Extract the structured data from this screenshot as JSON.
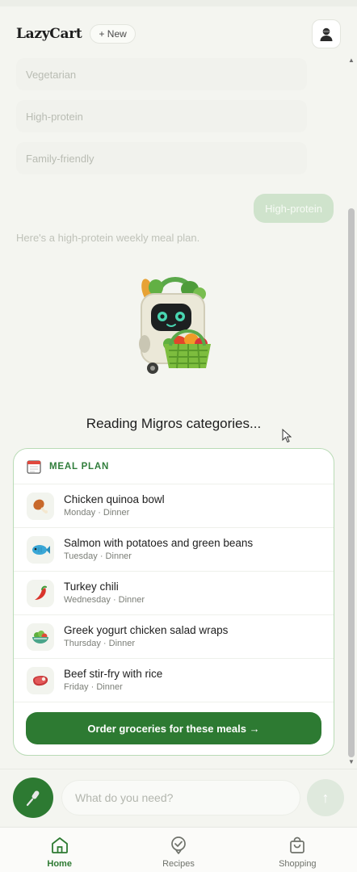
{
  "header": {
    "logo": "LazyCart",
    "new_label": "+ New",
    "profile_icon": "user-avatar-icon"
  },
  "chat": {
    "options": [
      "Vegetarian",
      "High-protein",
      "Family-friendly"
    ],
    "user_message": "High-protein",
    "assistant_message": "Here's a high-protein weekly meal plan.",
    "status": "Reading Migros categories..."
  },
  "meal_plan": {
    "title": "MEAL PLAN",
    "meals": [
      {
        "name": "Chicken quinoa bowl",
        "day": "Monday · Dinner",
        "icon": "drumstick-icon"
      },
      {
        "name": "Salmon with potatoes and green beans",
        "day": "Tuesday · Dinner",
        "icon": "fish-icon"
      },
      {
        "name": "Turkey chili",
        "day": "Wednesday · Dinner",
        "icon": "chili-pepper-icon"
      },
      {
        "name": "Greek yogurt chicken salad wraps",
        "day": "Thursday · Dinner",
        "icon": "salad-bowl-icon"
      },
      {
        "name": "Beef stir-fry with rice",
        "day": "Friday · Dinner",
        "icon": "steak-icon"
      }
    ],
    "order_label": "Order groceries for these meals →"
  },
  "composer": {
    "placeholder": "What do you need?",
    "send_symbol": "↑"
  },
  "nav": {
    "items": [
      {
        "label": "Home",
        "icon": "home-icon",
        "active": true
      },
      {
        "label": "Recipes",
        "icon": "recipes-icon",
        "active": false
      },
      {
        "label": "Shopping",
        "icon": "shopping-bag-icon",
        "active": false
      }
    ]
  },
  "colors": {
    "accent": "#2d7a32",
    "card_border": "#b9dbb6",
    "background": "#f4f5f0"
  }
}
